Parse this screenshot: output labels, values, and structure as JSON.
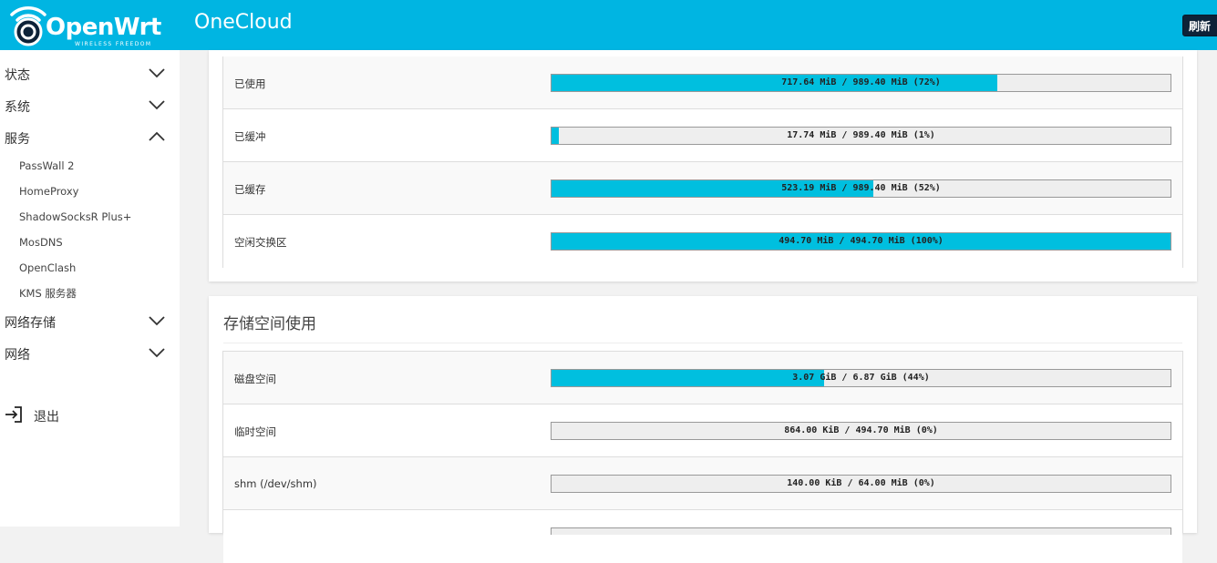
{
  "header": {
    "logo_text": "OpenWrt",
    "logo_tagline": "WIRELESS FREEDOM",
    "hostname": "OneCloud",
    "refresh_label": "刷新"
  },
  "sidebar": {
    "items": [
      {
        "label": "状态",
        "expanded": false
      },
      {
        "label": "系统",
        "expanded": false
      },
      {
        "label": "服务",
        "expanded": true
      },
      {
        "label": "网络存储",
        "expanded": false
      },
      {
        "label": "网络",
        "expanded": false
      }
    ],
    "services": [
      "PassWall 2",
      "HomeProxy",
      "ShadowSocksR Plus+",
      "MosDNS",
      "OpenClash",
      "KMS 服务器"
    ],
    "logout_label": "退出"
  },
  "memory": {
    "rows": [
      {
        "name": "已使用",
        "text": "717.64 MiB / 989.40 MiB (72%)",
        "percent": 72
      },
      {
        "name": "已缓冲",
        "text": "17.74 MiB / 989.40 MiB (1%)",
        "percent": 1
      },
      {
        "name": "已缓存",
        "text": "523.19 MiB / 989.40 MiB (52%)",
        "percent": 52
      },
      {
        "name": "空闲交换区",
        "text": "494.70 MiB / 494.70 MiB (100%)",
        "percent": 100
      }
    ]
  },
  "storage": {
    "title": "存储空间使用",
    "rows": [
      {
        "name": "磁盘空间",
        "text": "3.07 GiB / 6.87 GiB (44%)",
        "percent": 44
      },
      {
        "name": "临时空间",
        "text": "864.00 KiB / 494.70 MiB (0%)",
        "percent": 0
      },
      {
        "name": "shm (/dev/shm)",
        "text": "140.00 KiB / 64.00 MiB (0%)",
        "percent": 0
      }
    ]
  },
  "colors": {
    "header_bg": "#00b5e2",
    "bar_fill": "#00bfdf",
    "refresh_bg": "#0d2238"
  },
  "icons": {
    "logo": "openwrt-wifi-logo-icon",
    "chevron_down": "chevron-down-icon",
    "chevron_up": "chevron-up-icon",
    "logout": "logout-icon"
  }
}
